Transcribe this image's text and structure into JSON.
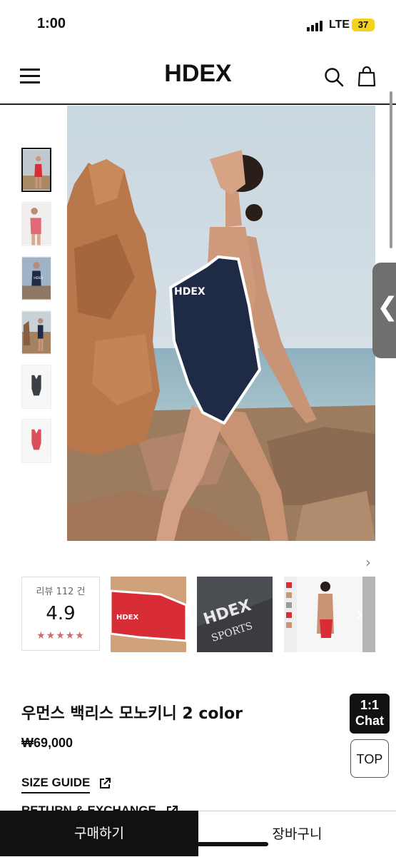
{
  "status_bar": {
    "time": "1:00",
    "network": "LTE",
    "battery": "37"
  },
  "header": {
    "logo": "HDEX"
  },
  "review_summary": {
    "label": "리뷰 112 건",
    "score": "4.9",
    "stars": "★★★★★",
    "rating": 5
  },
  "product": {
    "name": "우먼스 백리스 모노키니 2 color",
    "price": "₩69,000"
  },
  "links": {
    "size_guide": "SIZE GUIDE",
    "return_exchange": "RETURN & EXCHANGE"
  },
  "floating": {
    "chat_line1": "1:1",
    "chat_line2": "Chat",
    "top": "TOP"
  },
  "bottom_bar": {
    "buy": "구매하기",
    "cart": "장바구니"
  },
  "thumbnail_logo_text": "HDEX",
  "review_photo_text": {
    "logo": "HDEX",
    "sub": "SPORTS"
  },
  "icons": [
    "hamburger-icon",
    "search-icon",
    "bag-icon",
    "chevron-left-icon",
    "chevron-right-icon",
    "external-link-icon",
    "star-icon"
  ],
  "colors": {
    "accent": "#111111",
    "star": "#d26a6a",
    "swimsuit_navy": "#1f2a44",
    "swimsuit_red": "#d82c36"
  }
}
